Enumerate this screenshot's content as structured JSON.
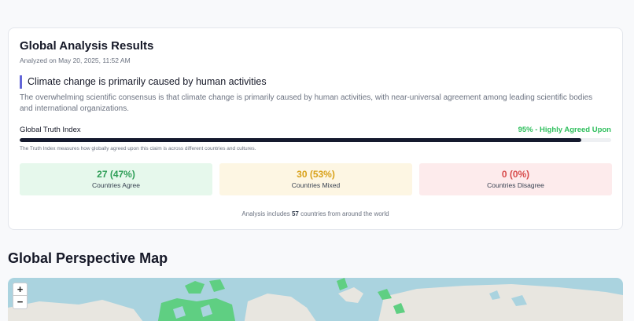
{
  "results": {
    "title": "Global Analysis Results",
    "analyzed": "Analyzed on May 20, 2025, 11:52 AM",
    "claim": "Climate change is primarily caused by human activities",
    "description": "The overwhelming scientific consensus is that climate change is primarily caused by human activities, with near-universal agreement among leading scientific bodies and international organizations.",
    "truth_index": {
      "label": "Global Truth Index",
      "value_text": "95% - Highly Agreed Upon",
      "percent": 95,
      "note": "The Truth Index measures how globally agreed upon this claim is across different countries and cultures."
    },
    "stats": {
      "agree": {
        "value": "27 (47%)",
        "label": "Countries Agree"
      },
      "mixed": {
        "value": "30 (53%)",
        "label": "Countries Mixed"
      },
      "disagree": {
        "value": "0 (0%)",
        "label": "Countries Disagree"
      }
    },
    "footnote": {
      "prefix": "Analysis includes ",
      "count": "57",
      "suffix": " countries from around the world"
    }
  },
  "map": {
    "title": "Global Perspective Map",
    "zoom_in": "+",
    "zoom_out": "−"
  },
  "colors": {
    "accent": "#6366d8",
    "agree": "#2fbf5d",
    "mixed": "#d9a21b",
    "disagree": "#d84c4c",
    "water": "#aad3df",
    "land": "#e8e6e0"
  }
}
